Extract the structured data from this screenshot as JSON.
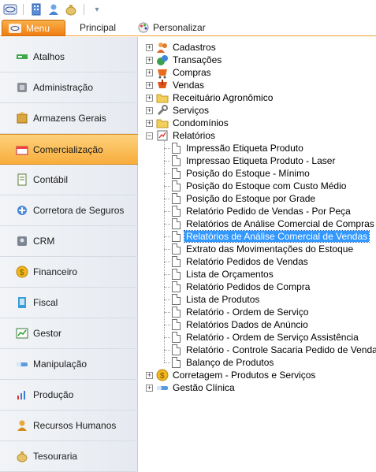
{
  "ribbon": {
    "menu_label": "Menu",
    "tabs": [
      "Principal",
      "Personalizar"
    ]
  },
  "nav": {
    "items": [
      {
        "label": "Atalhos",
        "icon": "shortcut-icon"
      },
      {
        "label": "Administração",
        "icon": "admin-icon"
      },
      {
        "label": "Armazens Gerais",
        "icon": "warehouse-icon"
      },
      {
        "label": "Comercialização",
        "icon": "commerce-icon",
        "active": true
      },
      {
        "label": "Contábil",
        "icon": "accounting-icon"
      },
      {
        "label": "Corretora de Seguros",
        "icon": "insurance-icon"
      },
      {
        "label": "CRM",
        "icon": "crm-icon"
      },
      {
        "label": "Financeiro",
        "icon": "finance-icon"
      },
      {
        "label": "Fiscal",
        "icon": "fiscal-icon"
      },
      {
        "label": "Gestor",
        "icon": "manager-icon"
      },
      {
        "label": "Manipulação",
        "icon": "manipulation-icon"
      },
      {
        "label": "Produção",
        "icon": "production-icon"
      },
      {
        "label": "Recursos Humanos",
        "icon": "hr-icon"
      },
      {
        "label": "Tesouraria",
        "icon": "treasury-icon"
      }
    ]
  },
  "tree": {
    "top_nodes": [
      {
        "label": "Cadastros",
        "icon": "people-icon"
      },
      {
        "label": "Transações",
        "icon": "transactions-icon"
      },
      {
        "label": "Compras",
        "icon": "purchases-icon"
      },
      {
        "label": "Vendas",
        "icon": "sales-icon"
      },
      {
        "label": "Receituário Agronômico",
        "icon": "folder-icon"
      },
      {
        "label": "Serviços",
        "icon": "wrench-icon"
      },
      {
        "label": "Condomínios",
        "icon": "folder-icon"
      }
    ],
    "relatorios": {
      "label": "Relatórios",
      "children": [
        "Impressão Etiqueta Produto",
        "Impressao Etiqueta Produto - Laser",
        "Posição do Estoque - Mínimo",
        "Posição do Estoque com Custo Médio",
        "Posição do Estoque por Grade",
        "Relatório Pedido de Vendas - Por Peça",
        "Relatórios de Análise Comercial de Compras",
        "Relatórios de Análise Comercial de Vendas",
        "Extrato das Movimentações do Estoque",
        "Relatório Pedidos de Vendas",
        "Lista de Orçamentos",
        "Relatório Pedidos de Compra",
        "Lista de Produtos",
        "Relatório - Ordem de Serviço",
        "Relatórios Dados de Anúncio",
        "Relatório - Ordem de Serviço Assistência",
        "Relatório - Controle Sacaria Pedido de Venda",
        "Balanço de Produtos"
      ],
      "selected_index": 7
    },
    "bottom_nodes": [
      {
        "label": "Corretagem - Produtos e Serviços",
        "icon": "coin-icon"
      },
      {
        "label": "Gestão Clínica",
        "icon": "clinic-icon"
      }
    ]
  },
  "colors": {
    "accent_orange": "#f59a2a",
    "selection_blue": "#3399ff"
  }
}
